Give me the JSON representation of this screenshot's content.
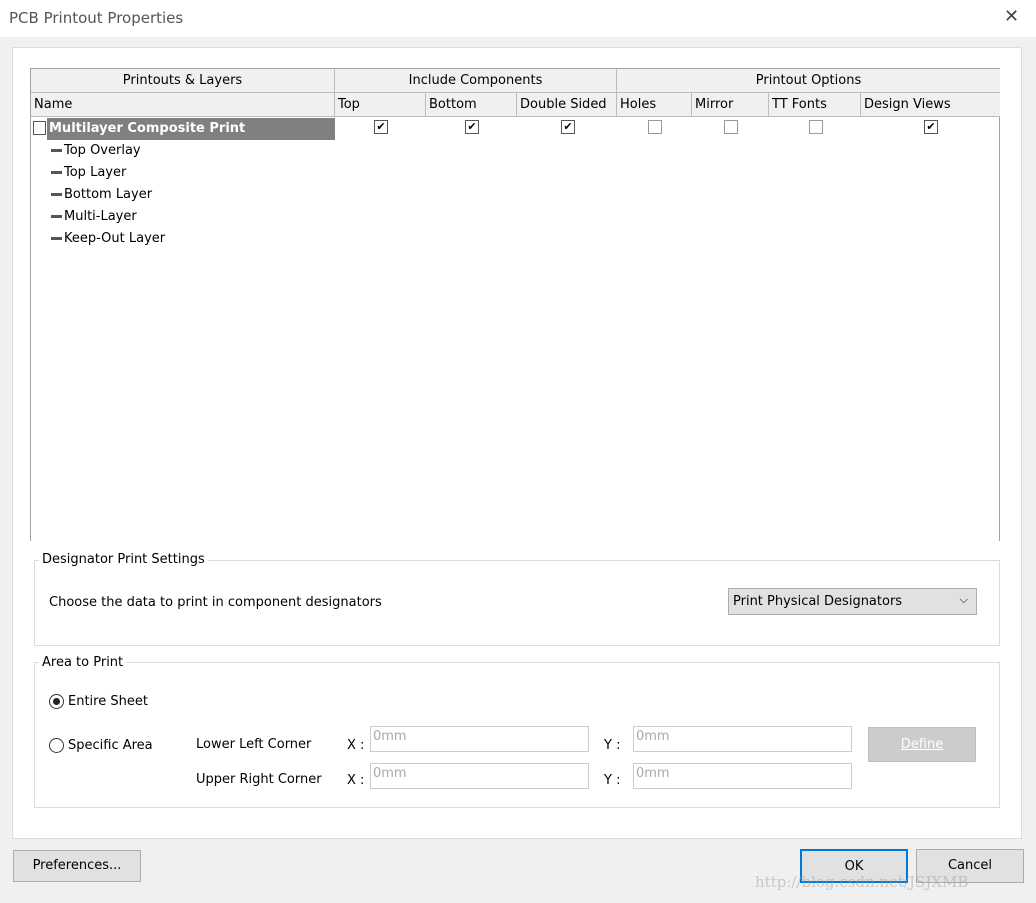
{
  "window": {
    "title": "PCB Printout Properties"
  },
  "table": {
    "groups": [
      "Printouts & Layers",
      "Include Components",
      "Printout Options"
    ],
    "columns": [
      "Name",
      "Top",
      "Bottom",
      "Double Sided",
      "Holes",
      "Mirror",
      "TT Fonts",
      "Design Views"
    ],
    "printout": {
      "name": "Multilayer Composite Print",
      "checks": [
        true,
        true,
        true,
        false,
        false,
        false,
        true
      ]
    },
    "layers": [
      "Top Overlay",
      "Top Layer",
      "Bottom Layer",
      "Multi-Layer",
      "Keep-Out Layer"
    ]
  },
  "designator": {
    "title": "Designator Print Settings",
    "label": "Choose the data to print in component designators",
    "selected": "Print Physical Designators"
  },
  "area": {
    "title": "Area to Print",
    "entire_sheet": "Entire Sheet",
    "specific_area": "Specific Area",
    "selected": "Entire Sheet",
    "lower_left": "Lower Left Corner",
    "upper_right": "Upper Right Corner",
    "x_label": "X :",
    "y_label": "Y :",
    "ll_x": "0mm",
    "ll_y": "0mm",
    "ur_x": "0mm",
    "ur_y": "0mm",
    "define": "Define"
  },
  "buttons": {
    "preferences": "Preferences...",
    "ok": "OK",
    "cancel": "Cancel"
  },
  "watermark": "http://blog.csdn.net/JSJXMB"
}
